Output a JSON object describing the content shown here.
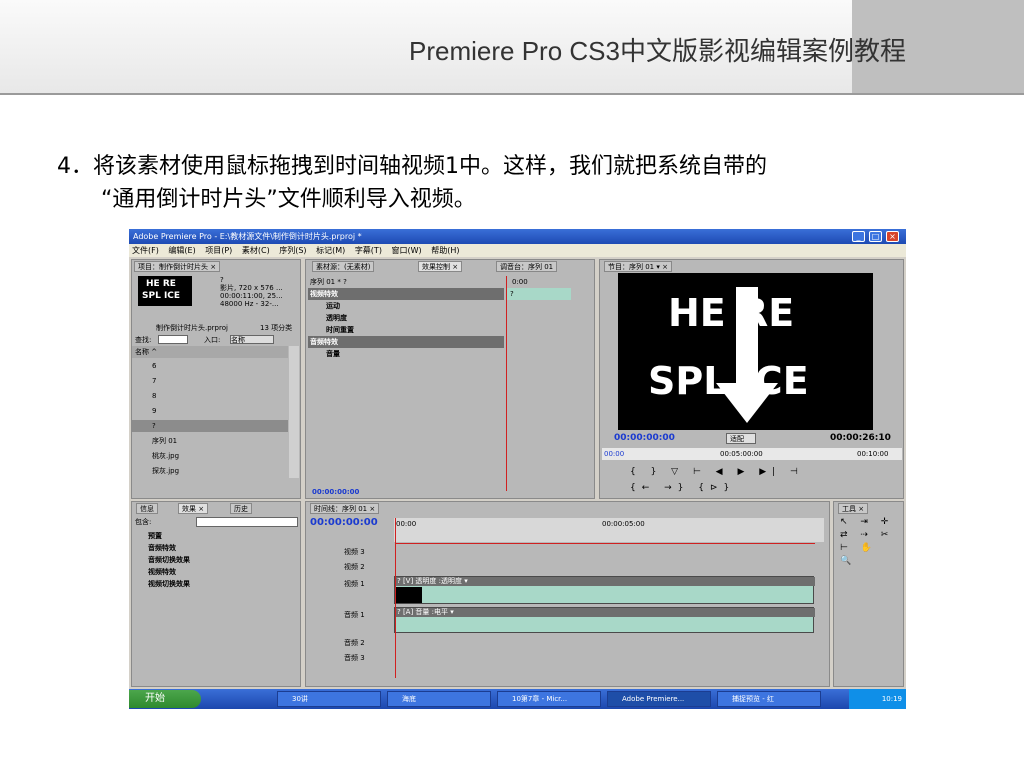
{
  "slide": {
    "header_title": "Premiere Pro CS3中文版影视编辑案例教程",
    "body_line1": "4．将该素材使用鼠标拖拽到时间轴视频1中。这样，我们就把系统自带的",
    "body_line2": "“通用倒计时片头”文件顺利导入视频。"
  },
  "app": {
    "window_title": "Adobe Premiere Pro - E:\\教材源文件\\制作倒计时片头.prproj *",
    "menu": [
      "文件(F)",
      "编辑(E)",
      "项目(P)",
      "素材(C)",
      "序列(S)",
      "标记(M)",
      "字幕(T)",
      "窗口(W)",
      "帮助(H)"
    ]
  },
  "project_panel": {
    "tab": "项目：制作倒计时片头 ×",
    "clip_name": "?",
    "clip_info1": "影片, 720 x 576 ...",
    "clip_info2": "00:00:11:00, 25...",
    "clip_info3": "48000 Hz - 32-...",
    "project_file": "制作倒计时片头.prproj",
    "item_count": "13 项分类",
    "find_label": "查找:",
    "entry_label": "入口:",
    "entry_value": "名称",
    "column_name": "名称 ^",
    "items": [
      "6",
      "7",
      "8",
      "9",
      "?",
      "序列 01",
      "桃灰.jpg",
      "探灰.jpg"
    ]
  },
  "effect_controls": {
    "tab_source": "素材源：(无素材)",
    "tab_effect": "效果控制 ×",
    "tab_mixer": "调音台：序列 01",
    "sequence_label": "序列 01 * ?",
    "timecode": "0:00",
    "clip_marker": "?",
    "video_effects": "视频特效",
    "motion": "运动",
    "opacity": "透明度",
    "time_remap": "时间重置",
    "audio_effects": "音频特效",
    "volume": "音量",
    "bottom_tc": "00:00:00:00"
  },
  "program_monitor": {
    "tab": "节目：序列 01 ▾ ×",
    "countdown_top": "HE RE",
    "countdown_bottom": "SPL ICE",
    "timecode_left": "00:00:00:00",
    "fit_label": "适配",
    "timecode_right": "00:00:26:10",
    "ruler_left": "00:00",
    "ruler_mid": "00:05:00:00",
    "ruler_right": "00:10:00"
  },
  "effects_panel": {
    "tab_info": "信息",
    "tab_effects": "效果 ×",
    "tab_history": "历史",
    "contains_label": "包含:",
    "folders": [
      "预置",
      "音频特效",
      "音频切换效果",
      "视频特效",
      "视频切换效果"
    ]
  },
  "timeline": {
    "tab": "时间线：序列 01 ×",
    "timecode": "00:00:00:00",
    "ruler_start": "00:00",
    "ruler_mid": "00:00:05:00",
    "tracks": [
      "视频 3",
      "视频 2",
      "视频 1",
      "音频 1",
      "音频 2",
      "音频 3"
    ],
    "video_clip_label": "? [V] 透明度 :透明度 ▾",
    "audio_clip_label": "? [A] 音量 :电平 ▾"
  },
  "tools_panel": {
    "tab": "工具 ×"
  },
  "taskbar": {
    "start": "开始",
    "items": [
      "30讲",
      "海底",
      "10第7章 - Micr...",
      "Adobe Premiere...",
      "捕捉预览 - 红"
    ],
    "clock": "10:19"
  },
  "colors": {
    "header_bg": "#e8e8e8",
    "header_title": "#333333",
    "xp_blue": "#1d4ab3",
    "timecode_blue": "#1a3ad0",
    "playhead_red": "#d02020",
    "clip_teal": "#a8d8c8"
  }
}
